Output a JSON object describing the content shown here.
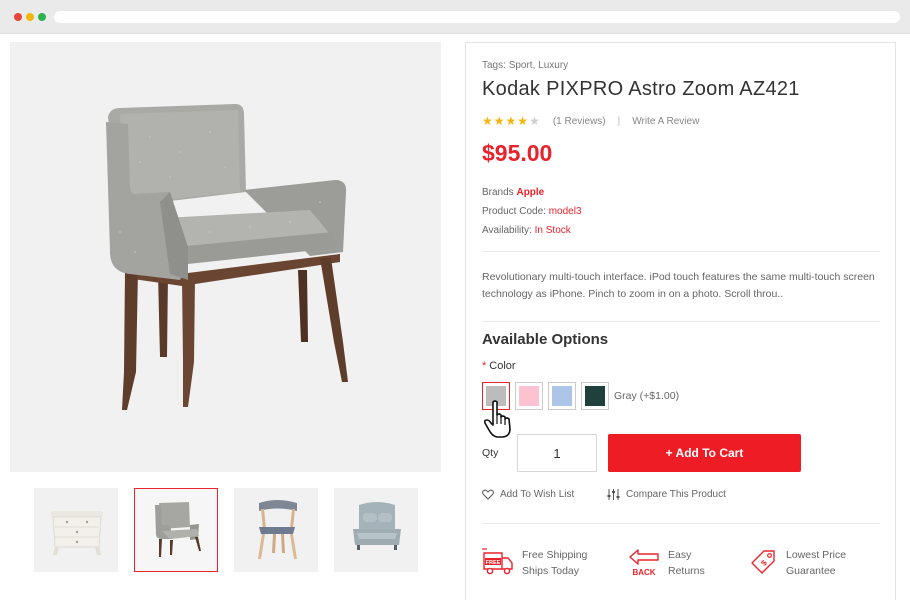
{
  "product": {
    "tags_label": "Tags:",
    "tags": [
      "Sport",
      "Luxury"
    ],
    "title": "Kodak PIXPRO Astro Zoom AZ421",
    "rating": 4,
    "rating_max": 5,
    "reviews_text": "(1 Reviews)",
    "divider": "|",
    "write_review": "Write A Review",
    "price": "$95.00",
    "brand_label": "Brands",
    "brand_value": "Apple",
    "code_label": "Product Code:",
    "code_value": "model3",
    "availability_label": "Availability:",
    "availability_value": "In Stock",
    "description": "Revolutionary multi-touch interface. iPod touch features the same multi-touch screen technology as iPhone. Pinch to zoom in on a photo. Scroll throu.."
  },
  "options": {
    "title": "Available Options",
    "required_mark": "*",
    "color_label": "Color",
    "swatches": [
      {
        "name": "gray",
        "color": "#bcbcbc",
        "selected": true
      },
      {
        "name": "pink",
        "color": "#fbc3d0",
        "selected": false
      },
      {
        "name": "blue",
        "color": "#adc5e6",
        "selected": false
      },
      {
        "name": "dark-teal",
        "color": "#1f403d",
        "selected": false
      }
    ],
    "selected_text": "Gray (+$1.00)"
  },
  "purchase": {
    "qty_label": "Qty",
    "qty_value": "1",
    "add_to_cart": "+ Add To Cart"
  },
  "actions": {
    "wishlist": "Add To Wish List",
    "compare": "Compare This Product"
  },
  "features": [
    {
      "icon": "free-shipping-truck-icon",
      "line1": "Free Shipping",
      "line2": "Ships Today"
    },
    {
      "icon": "back-arrow-icon",
      "line1": "Easy",
      "line2": "Returns"
    },
    {
      "icon": "price-tag-icon",
      "line1": "Lowest Price",
      "line2": "Guarantee"
    }
  ],
  "icons": {
    "free_badge_text": "FREE",
    "back_badge_text": "BACK"
  },
  "thumbnails": [
    {
      "name": "white-dresser",
      "active": false
    },
    {
      "name": "gray-armchair",
      "active": true
    },
    {
      "name": "wood-blue-chair",
      "active": false
    },
    {
      "name": "gray-sofa-chair",
      "active": false
    }
  ],
  "colors": {
    "accent": "#e8232b",
    "star": "#f5b50a"
  }
}
